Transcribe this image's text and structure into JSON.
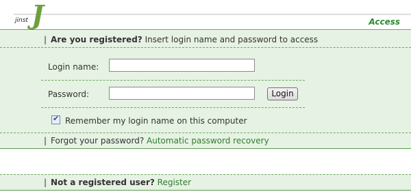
{
  "header": {
    "logo_small": "jinst",
    "logo_letter": "J",
    "access_label": "Access"
  },
  "login_section": {
    "question": "Are you registered?",
    "instruction": "Insert login name and password to access",
    "login_label": "Login name:",
    "login_value": "",
    "password_label": "Password:",
    "password_value": "",
    "login_button": "Login",
    "remember_label": "Remember my login name on this computer",
    "remember_checked": true
  },
  "forgot": {
    "text": "Forgot your password?",
    "link": "Automatic password recovery"
  },
  "register": {
    "question": "Not a registered user?",
    "link": "Register"
  },
  "colors": {
    "band": "#e6f2e3",
    "accent": "#2f7d2f",
    "border": "#5c9a51"
  }
}
